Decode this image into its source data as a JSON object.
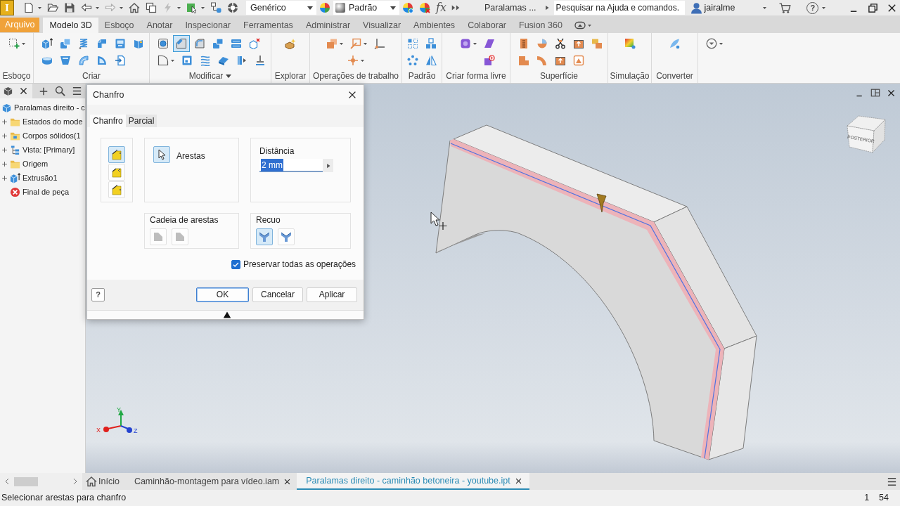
{
  "title_bar": {
    "app_logo": "I",
    "quick_access": [
      {
        "disabled": false
      },
      {
        "disabled": false
      },
      {
        "disabled": false
      },
      {
        "disabled": false
      },
      {
        "disabled": true
      },
      {
        "disabled": false
      },
      {
        "disabled": false
      },
      {
        "disabled": true
      },
      {
        "disabled": false
      },
      {
        "disabled": false
      },
      {
        "disabled": false
      }
    ],
    "appearance": "Genérico",
    "style": "Padrão",
    "function_button": "fx",
    "document": "Paralamas ...",
    "search": {
      "placeholder": "Pesquisar na Ajuda e comandos."
    },
    "user": "jairalme",
    "help": "?"
  },
  "ribbon_tabs": [
    {
      "label": "Arquivo",
      "kind": "menu",
      "selected": false
    },
    {
      "label": "Modelo 3D",
      "kind": "tab",
      "selected": true
    },
    {
      "label": "Esboço",
      "kind": "tab",
      "selected": false
    },
    {
      "label": "Anotar",
      "kind": "tab",
      "selected": false
    },
    {
      "label": "Inspecionar",
      "kind": "tab",
      "selected": false
    },
    {
      "label": "Ferramentas",
      "kind": "tab",
      "selected": false
    },
    {
      "label": "Administrar",
      "kind": "tab",
      "selected": false
    },
    {
      "label": "Visualizar",
      "kind": "tab",
      "selected": false
    },
    {
      "label": "Ambientes",
      "kind": "tab",
      "selected": false
    },
    {
      "label": "Colaborar",
      "kind": "tab",
      "selected": false
    },
    {
      "label": "Fusion 360",
      "kind": "tab",
      "selected": false
    }
  ],
  "ribbon_groups": [
    {
      "label": "Esboço",
      "dropdown": false,
      "buttons": [
        {
          "selected": false
        }
      ]
    },
    {
      "label": "Criar",
      "dropdown": false,
      "buttons": [
        {
          "selected": false
        },
        {
          "selected": false
        },
        {
          "selected": false
        },
        {
          "selected": false
        },
        {
          "selected": false
        },
        {
          "selected": false
        },
        {
          "selected": false
        },
        {
          "selected": false
        },
        {
          "selected": false
        },
        {
          "selected": false
        },
        {
          "selected": false
        }
      ]
    },
    {
      "label": "Modificar",
      "dropdown": true,
      "buttons": [
        {
          "selected": false
        },
        {
          "selected": true
        },
        {
          "selected": false
        },
        {
          "selected": false
        },
        {
          "selected": false
        },
        {
          "selected": false
        },
        {
          "selected": false
        },
        {
          "selected": false
        },
        {
          "selected": false
        },
        {
          "selected": false
        },
        {
          "selected": false
        },
        {
          "selected": false
        }
      ]
    },
    {
      "label": "Explorar",
      "dropdown": false,
      "buttons": [
        {
          "selected": false
        }
      ]
    },
    {
      "label": "Operações de trabalho",
      "dropdown": false,
      "buttons": [
        {
          "selected": false
        },
        {
          "selected": false
        },
        {
          "selected": false
        },
        {
          "selected": false
        }
      ]
    },
    {
      "label": "Padrão",
      "dropdown": false,
      "buttons": [
        {
          "selected": false
        },
        {
          "selected": false
        },
        {
          "selected": false
        },
        {
          "selected": false
        }
      ]
    },
    {
      "label": "Criar forma livre",
      "dropdown": false,
      "buttons": [
        {
          "selected": false
        },
        {
          "selected": false
        },
        {
          "selected": false
        }
      ]
    },
    {
      "label": "Superfície",
      "dropdown": false,
      "buttons": [
        {
          "selected": false
        },
        {
          "selected": false
        },
        {
          "selected": false
        },
        {
          "selected": false
        },
        {
          "selected": false
        },
        {
          "selected": false
        },
        {
          "selected": false
        },
        {
          "selected": false
        },
        {
          "selected": false
        }
      ]
    },
    {
      "label": "Simulação",
      "dropdown": false,
      "buttons": [
        {
          "selected": false
        }
      ]
    },
    {
      "label": "Converter",
      "dropdown": false,
      "buttons": [
        {
          "selected": false
        }
      ]
    },
    {
      "buttons": [
        {
          "selected": false
        }
      ]
    }
  ],
  "browser": {
    "tree": [
      {
        "label": "Paralamas direito - c",
        "kind": "part",
        "children": [
          {
            "label": "Estados do mode",
            "kind": "folder",
            "expanded": false
          },
          {
            "label": "Corpos sólidos(1",
            "kind": "bodies",
            "expanded": false
          },
          {
            "label": "Vista: [Primary]",
            "kind": "view",
            "expanded": false
          },
          {
            "label": "Origem",
            "kind": "folder",
            "expanded": false
          },
          {
            "label": "Extrusão1",
            "kind": "extrusion",
            "expanded": false
          },
          {
            "label": "Final de peça",
            "kind": "end"
          }
        ]
      }
    ]
  },
  "dialog": {
    "title": "Chanfro",
    "tabs": [
      {
        "label": "Chanfro",
        "selected": true
      },
      {
        "label": "Parcial",
        "selected": false
      }
    ],
    "methods": [
      {
        "selected": true
      },
      {
        "selected": false
      },
      {
        "selected": false
      }
    ],
    "edges": {
      "label": "Arestas",
      "selected": true
    },
    "distance": {
      "label": "Distância",
      "value": "2 mm",
      "value_selected": true
    },
    "edge_chain": {
      "label": "Cadeia de arestas",
      "options": [
        {
          "selected": false
        },
        {
          "selected": false
        }
      ]
    },
    "setback": {
      "label": "Recuo",
      "options": [
        {
          "selected": true
        },
        {
          "selected": false
        }
      ]
    },
    "preserve": {
      "label": "Preservar todas as operações",
      "checked": true
    },
    "help": "?",
    "buttons": [
      {
        "label": "OK",
        "kind": "default"
      },
      {
        "label": "Cancelar",
        "kind": "normal"
      },
      {
        "label": "Aplicar",
        "kind": "normal"
      }
    ]
  },
  "viewport": {
    "view_cube": {
      "label": "POSTERIOR"
    },
    "axes": [
      {
        "label": "X",
        "color": "#e0201c"
      },
      {
        "label": "Y",
        "color": "#20a844"
      },
      {
        "label": "Z",
        "color": "#2443d0"
      }
    ]
  },
  "document_tabs": [
    {
      "label": "Início",
      "kind": "home",
      "selected": false
    },
    {
      "label": "Caminhão-montagem para vídeo.iam",
      "kind": "document",
      "selected": false
    },
    {
      "label": "Paralamas direito - caminhão betoneira - youtube.ipt",
      "kind": "document",
      "selected": true
    }
  ],
  "status_bar": {
    "message": "Selecionar arestas para chanfro",
    "values": [
      "1",
      "54"
    ]
  }
}
